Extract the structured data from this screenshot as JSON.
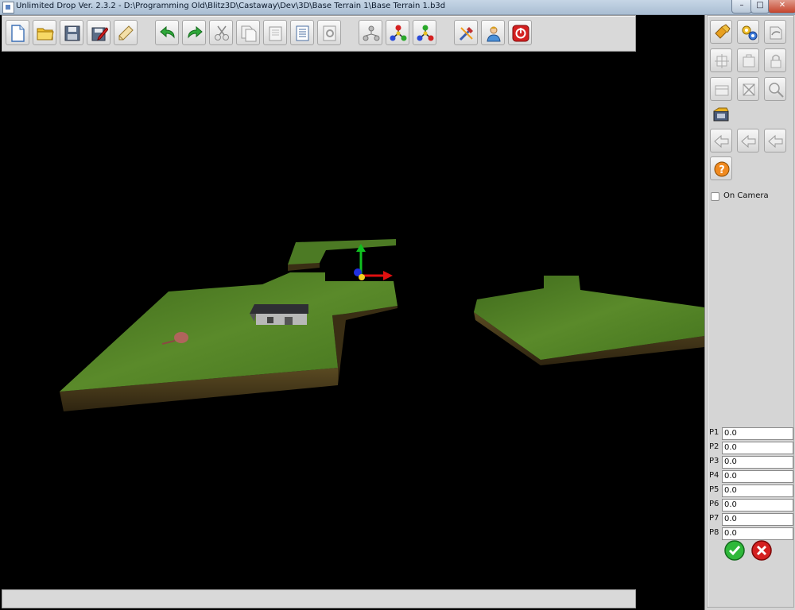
{
  "window": {
    "title": "Unlimited Drop Ver. 2.3.2 - D:\\Programming Old\\Blitz3D\\Castaway\\Dev\\3D\\Base Terrain 1\\Base Terrain 1.b3d",
    "minimize_glyph": "–",
    "maximize_glyph": "□",
    "close_glyph": "✕"
  },
  "toolbar": {
    "buttons": [
      {
        "name": "new-file",
        "icon": "new-document-icon"
      },
      {
        "name": "open-file",
        "icon": "open-folder-icon"
      },
      {
        "name": "save",
        "icon": "floppy-disk-icon"
      },
      {
        "name": "save-as",
        "icon": "save-edit-icon"
      },
      {
        "name": "properties",
        "icon": "pencil-note-icon"
      },
      {
        "name": "undo",
        "icon": "undo-arrow-icon"
      },
      {
        "name": "redo",
        "icon": "redo-arrow-icon"
      },
      {
        "name": "cut",
        "icon": "scissors-icon"
      },
      {
        "name": "copy",
        "icon": "copy-icon"
      },
      {
        "name": "paste",
        "icon": "paste-icon"
      },
      {
        "name": "document-list",
        "icon": "document-list-icon"
      },
      {
        "name": "settings-page",
        "icon": "page-settings-icon"
      },
      {
        "name": "hierarchy",
        "icon": "hierarchy-icon"
      },
      {
        "name": "molecule-colored",
        "icon": "molecule-icon"
      },
      {
        "name": "molecule-alt",
        "icon": "molecule-alt-icon"
      },
      {
        "name": "tools",
        "icon": "tools-icon"
      },
      {
        "name": "user",
        "icon": "user-icon"
      },
      {
        "name": "power",
        "icon": "power-icon"
      }
    ]
  },
  "sidebar": {
    "tool_buttons": [
      {
        "name": "brush",
        "icon": "brush-icon"
      },
      {
        "name": "gears",
        "icon": "gears-icon"
      },
      {
        "name": "rotate-object",
        "icon": "rotate-object-icon"
      },
      {
        "name": "move-object",
        "icon": "move-object-icon"
      },
      {
        "name": "scale-object",
        "icon": "scale-object-icon"
      },
      {
        "name": "lock-object",
        "icon": "lock-object-icon"
      },
      {
        "name": "group-object",
        "icon": "group-object-icon"
      },
      {
        "name": "delete-object",
        "icon": "delete-object-icon"
      },
      {
        "name": "zoom-object",
        "icon": "zoom-object-icon"
      },
      {
        "name": "camera",
        "icon": "camera-icon"
      },
      {
        "name": "arrow-left-1",
        "icon": "arrow-left-icon"
      },
      {
        "name": "arrow-left-2",
        "icon": "arrow-left-icon"
      },
      {
        "name": "arrow-left-3",
        "icon": "arrow-left-icon"
      },
      {
        "name": "help",
        "icon": "question-icon"
      }
    ],
    "on_camera_label": "On Camera",
    "on_camera_checked": false,
    "params": [
      {
        "label": "P1",
        "value": "0.0"
      },
      {
        "label": "P2",
        "value": "0.0"
      },
      {
        "label": "P3",
        "value": "0.0"
      },
      {
        "label": "P4",
        "value": "0.0"
      },
      {
        "label": "P5",
        "value": "0.0"
      },
      {
        "label": "P6",
        "value": "0.0"
      },
      {
        "label": "P7",
        "value": "0.0"
      },
      {
        "label": "P8",
        "value": "0.0"
      }
    ]
  },
  "colors": {
    "grass": "#4a7a22",
    "soil": "#4b3b1c",
    "axis_x": "#e01010",
    "axis_y": "#10c020",
    "axis_z": "#2030e0"
  }
}
